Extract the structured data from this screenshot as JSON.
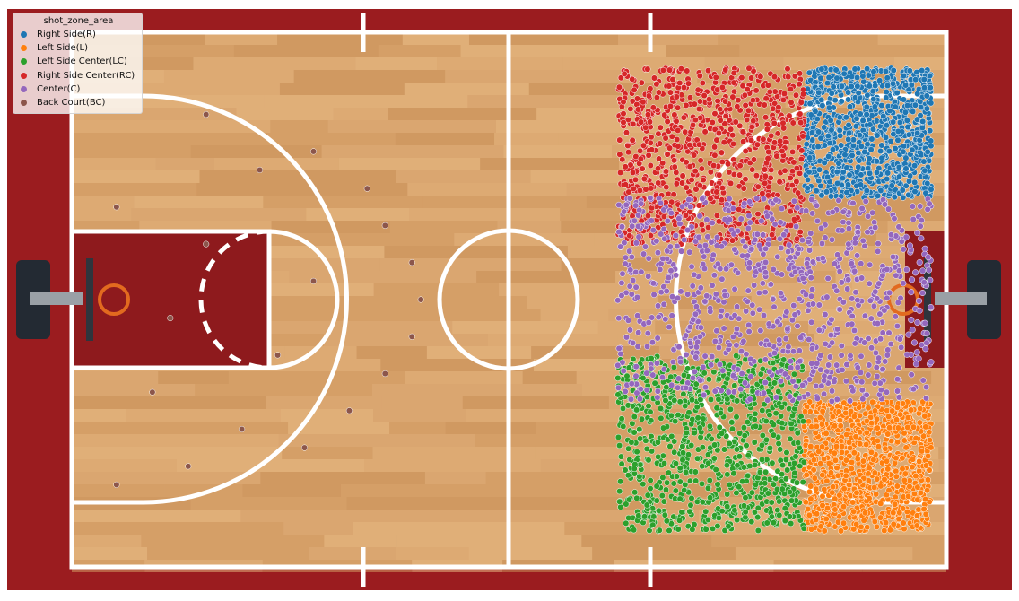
{
  "chart_data": {
    "type": "scatter",
    "title": "",
    "xlabel": "",
    "ylabel": "",
    "background": "basketball court image",
    "xlim": [
      -250,
      1000
    ],
    "ylim": [
      -52,
      890
    ],
    "grid": false,
    "legend": {
      "title": "shot_zone_area",
      "placement": "top-left",
      "entries": [
        {
          "name": "Right Side(R)",
          "color": "#1f77b4"
        },
        {
          "name": "Left Side(L)",
          "color": "#ff7f0e"
        },
        {
          "name": "Left Side Center(LC)",
          "color": "#2ca02c"
        },
        {
          "name": "Right Side Center(RC)",
          "color": "#d62728"
        },
        {
          "name": "Center(C)",
          "color": "#9467bd"
        },
        {
          "name": "Back Court(BC)",
          "color": "#8c564b"
        }
      ]
    },
    "series": [
      {
        "name": "Right Side(R)",
        "color": "#1f77b4",
        "region": {
          "x": [
            -250,
            -110
          ],
          "y": [
            -50,
            92
          ]
        },
        "density": "dense"
      },
      {
        "name": "Left Side(L)",
        "color": "#ff7f0e",
        "region": {
          "x": [
            110,
            250
          ],
          "y": [
            -50,
            92
          ]
        },
        "density": "dense"
      },
      {
        "name": "Left Side Center(LC)",
        "color": "#2ca02c",
        "region": {
          "x": [
            60,
            250
          ],
          "y": [
            92,
            300
          ]
        },
        "density": "dense"
      },
      {
        "name": "Right Side Center(RC)",
        "color": "#d62728",
        "region": {
          "x": [
            -250,
            -60
          ],
          "y": [
            92,
            300
          ]
        },
        "density": "dense"
      },
      {
        "name": "Center(C)",
        "color": "#9467bd",
        "region": {
          "x": [
            -110,
            110
          ],
          "y": [
            -50,
            300
          ]
        },
        "density": "dense"
      },
      {
        "name": "Back Court(BC)",
        "color": "#8c564b",
        "region": {
          "x": [
            -250,
            250
          ],
          "y": [
            460,
            890
          ]
        },
        "density": "sparse",
        "points": [
          [
            -140,
            700
          ],
          [
            -160,
            640
          ],
          [
            -120,
            580
          ],
          [
            -80,
            560
          ],
          [
            -40,
            530
          ],
          [
            0,
            520
          ],
          [
            40,
            530
          ],
          [
            80,
            560
          ],
          [
            120,
            600
          ],
          [
            160,
            650
          ],
          [
            -200,
            760
          ],
          [
            -60,
            760
          ],
          [
            20,
            800
          ],
          [
            100,
            820
          ],
          [
            180,
            780
          ],
          [
            -20,
            640
          ],
          [
            60,
            680
          ],
          [
            140,
            720
          ],
          [
            -100,
            860
          ],
          [
            200,
            860
          ]
        ]
      }
    ]
  }
}
